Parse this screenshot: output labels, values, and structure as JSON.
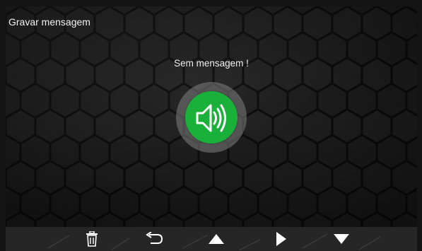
{
  "screen": {
    "title": "Gravar mensagem",
    "status_message": "Sem mensagem !"
  },
  "play_button": {
    "icon": "speaker-icon",
    "color": "#19b139"
  },
  "toolbar": {
    "buttons": [
      {
        "icon": "trash-icon"
      },
      {
        "icon": "back-icon"
      },
      {
        "icon": "up-arrow-icon"
      },
      {
        "icon": "play-arrow-icon"
      },
      {
        "icon": "down-arrow-icon"
      }
    ]
  }
}
